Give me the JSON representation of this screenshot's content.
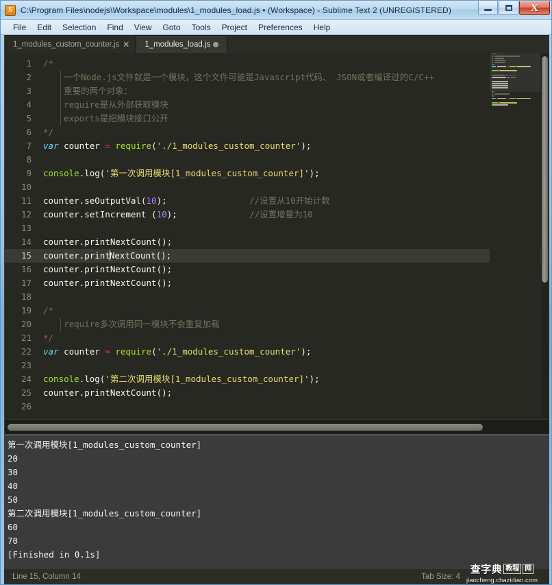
{
  "window": {
    "title": "C:\\Program Files\\nodejs\\Workspace\\modules\\1_modules_load.js • (Workspace) - Sublime Text 2 (UNREGISTERED)",
    "app_icon_letter": "S",
    "minimize_label": "Minimize",
    "maximize_label": "Maximize",
    "close_label": "X"
  },
  "menubar": {
    "items": [
      {
        "label": "File"
      },
      {
        "label": "Edit"
      },
      {
        "label": "Selection"
      },
      {
        "label": "Find"
      },
      {
        "label": "View"
      },
      {
        "label": "Goto"
      },
      {
        "label": "Tools"
      },
      {
        "label": "Project"
      },
      {
        "label": "Preferences"
      },
      {
        "label": "Help"
      }
    ]
  },
  "tabs": [
    {
      "label": "1_modules_custom_counter.js",
      "active": false,
      "dirty": false,
      "close_glyph": "✕"
    },
    {
      "label": "1_modules_load.js",
      "active": true,
      "dirty": true,
      "close_glyph": "✕"
    }
  ],
  "editor": {
    "current_line": 15,
    "first_line": 1,
    "last_line": 26,
    "caret_line": 15,
    "caret_column": 14,
    "lines": [
      {
        "n": 1,
        "text": "/*"
      },
      {
        "n": 2,
        "text": "    一个Node.js文件就是一个模块，这个文件可能是Javascript代码、 JSON或者编译过的C/C++"
      },
      {
        "n": 3,
        "text": "    重要的两个对象："
      },
      {
        "n": 4,
        "text": "    require是从外部获取模块"
      },
      {
        "n": 5,
        "text": "    exports是把模块接口公开"
      },
      {
        "n": 6,
        "text": "*/"
      },
      {
        "n": 7,
        "text": "var counter = require('./1_modules_custom_counter');"
      },
      {
        "n": 8,
        "text": ""
      },
      {
        "n": 9,
        "text": "console.log('第一次调用模块[1_modules_custom_counter]');"
      },
      {
        "n": 10,
        "text": ""
      },
      {
        "n": 11,
        "text": "counter.seOutputVal(10);                //设置从10开始计数"
      },
      {
        "n": 12,
        "text": "counter.setIncrement (10);              //设置增量为10"
      },
      {
        "n": 13,
        "text": ""
      },
      {
        "n": 14,
        "text": "counter.printNextCount();"
      },
      {
        "n": 15,
        "text": "counter.printNextCount();"
      },
      {
        "n": 16,
        "text": "counter.printNextCount();"
      },
      {
        "n": 17,
        "text": "counter.printNextCount();"
      },
      {
        "n": 18,
        "text": ""
      },
      {
        "n": 19,
        "text": "/*"
      },
      {
        "n": 20,
        "text": "    require多次调用同一模块不会重复加载"
      },
      {
        "n": 21,
        "text": "*/"
      },
      {
        "n": 22,
        "text": "var counter = require('./1_modules_custom_counter');"
      },
      {
        "n": 23,
        "text": ""
      },
      {
        "n": 24,
        "text": "console.log('第二次调用模块[1_modules_custom_counter]');"
      },
      {
        "n": 25,
        "text": "counter.printNextCount();"
      },
      {
        "n": 26,
        "text": ""
      }
    ],
    "tokens": {
      "comment_color": "#75715e",
      "keyword_color": "#66d9ef",
      "function_color": "#a6e22e",
      "string_color": "#e6db74",
      "number_color": "#ae81ff",
      "operator_color": "#f92672",
      "plain_color": "#f8f8f2",
      "background_color": "#272822"
    }
  },
  "console": {
    "lines": [
      "第一次调用模块[1_modules_custom_counter]",
      "20",
      "30",
      "40",
      "50",
      "第二次调用模块[1_modules_custom_counter]",
      "60",
      "70",
      "[Finished in 0.1s]"
    ],
    "background_color": "#3b3b3b"
  },
  "statusbar": {
    "position": "Line 15, Column 14",
    "tab_size": "Tab Size: 4"
  },
  "watermark": {
    "cn_text": "查字典",
    "box1": "教程",
    "box2": "网",
    "url": "jiaocheng.chazidian.com"
  }
}
